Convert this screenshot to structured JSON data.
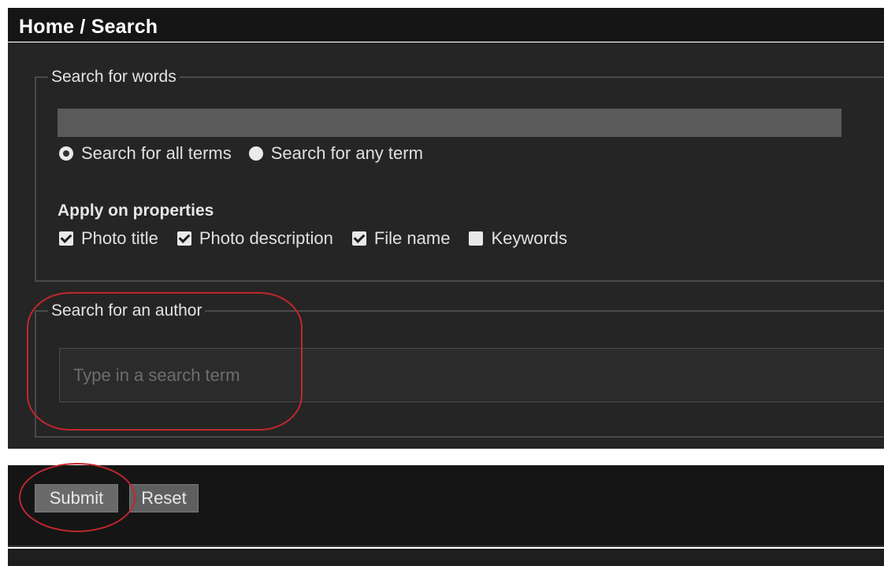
{
  "header": {
    "breadcrumb": "Home / Search"
  },
  "search_words": {
    "legend": "Search for words",
    "input_value": "",
    "radios": [
      {
        "label": "Search for all terms",
        "checked": true
      },
      {
        "label": "Search for any term",
        "checked": false
      }
    ],
    "apply_heading": "Apply on properties",
    "properties": [
      {
        "label": "Photo title",
        "checked": true
      },
      {
        "label": "Photo description",
        "checked": true
      },
      {
        "label": "File name",
        "checked": true
      },
      {
        "label": "Keywords",
        "checked": false
      }
    ]
  },
  "search_author": {
    "legend": "Search for an author",
    "placeholder": "Type in a search term",
    "value": ""
  },
  "actions": {
    "submit_label": "Submit",
    "reset_label": "Reset"
  },
  "colors": {
    "background": "#252525",
    "header": "#151515",
    "annotation": "#c0272d"
  }
}
